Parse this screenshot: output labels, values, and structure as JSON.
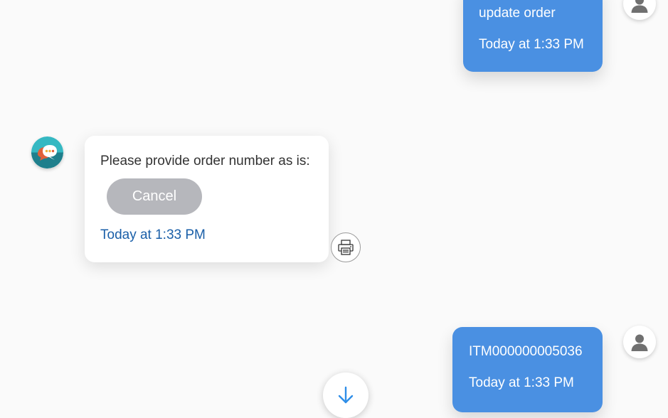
{
  "messages": [
    {
      "sender": "user",
      "text": "update order",
      "time": "Today at 1:33 PM"
    },
    {
      "sender": "bot",
      "text": "Please provide order number as is:",
      "button_label": "Cancel",
      "time": "Today at 1:33 PM"
    },
    {
      "sender": "user",
      "text": "ITM000000005036",
      "time": "Today at 1:33 PM"
    }
  ],
  "icons": {
    "user_avatar": "user-silhouette-icon",
    "bot_avatar": "chat-bubble-logo-icon",
    "print": "printer-icon",
    "scroll_down": "arrow-down-icon"
  },
  "colors": {
    "user_bubble": "#4a90e2",
    "bot_time": "#1a5fa8",
    "cancel_button": "#b6b7bc",
    "scroll_arrow": "#2f8ee8",
    "background": "#fafafa"
  }
}
